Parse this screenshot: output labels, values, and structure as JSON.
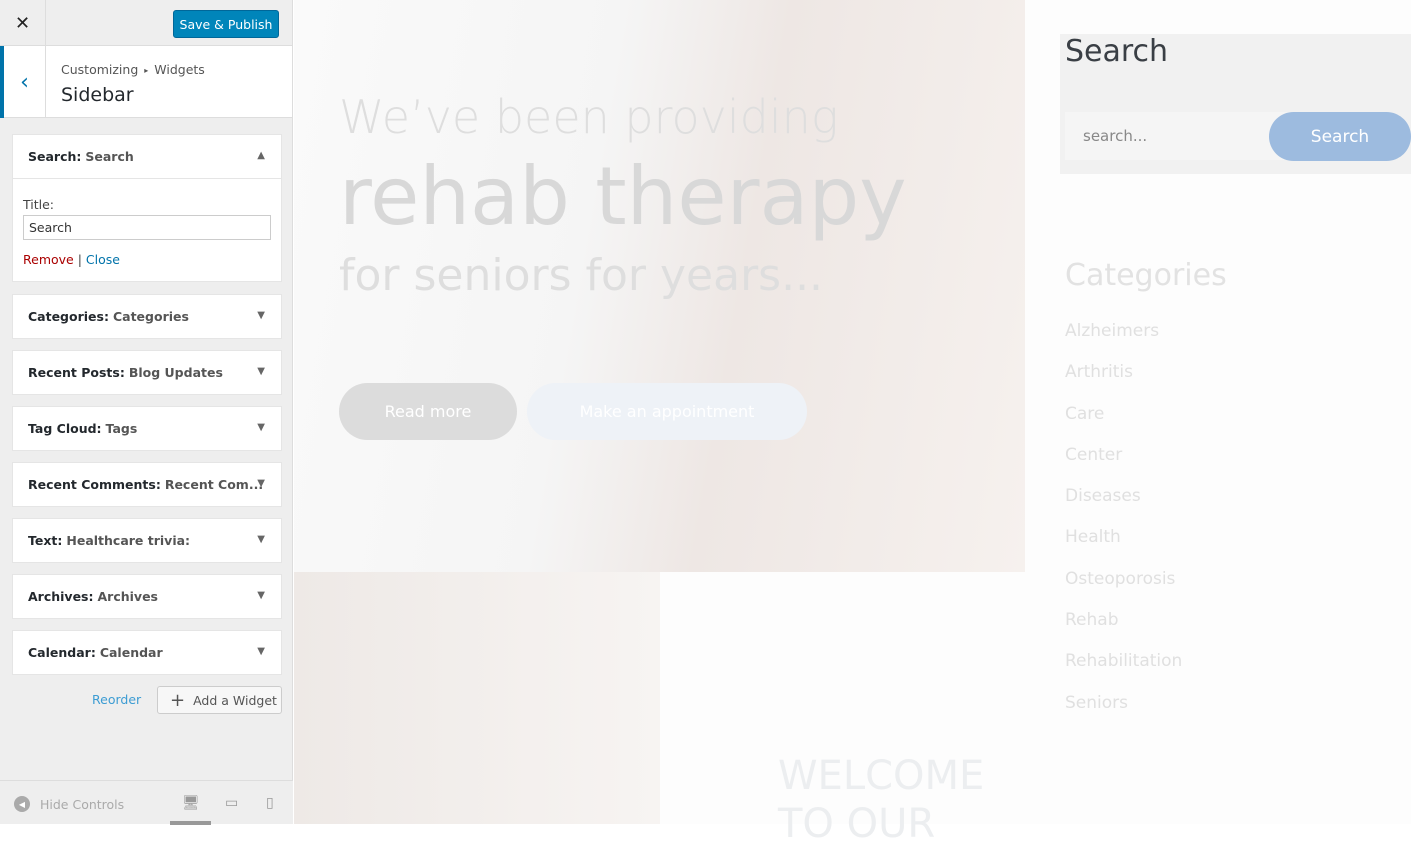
{
  "panel": {
    "close_icon": "close-icon",
    "publish": "Save & Publish",
    "breadcrumb": {
      "root": "Customizing",
      "separator": "▸",
      "section": "Widgets"
    },
    "title": "Sidebar",
    "expanded_widget": {
      "type": "Search:",
      "name": "Search",
      "title_label": "Title:",
      "title_value": "Search",
      "remove": "Remove",
      "sep": "|",
      "close": "Close"
    },
    "widgets": [
      {
        "type": "Categories:",
        "name": "Categories"
      },
      {
        "type": "Recent Posts:",
        "name": "Blog Updates"
      },
      {
        "type": "Tag Cloud:",
        "name": "Tags"
      },
      {
        "type": "Recent Comments:",
        "name": "Recent Com..."
      },
      {
        "type": "Text:",
        "name": "Healthcare trivia:"
      },
      {
        "type": "Archives:",
        "name": "Archives"
      },
      {
        "type": "Calendar:",
        "name": "Calendar"
      }
    ],
    "reorder": "Reorder",
    "add_widget": "Add a Widget",
    "hide_controls": "Hide Controls"
  },
  "preview": {
    "hero": {
      "line1": "We’ve been providing",
      "line2": "rehab therapy",
      "line3": "for seniors for years...",
      "read_more": "Read more",
      "appointment": "Make an appointment"
    },
    "welcome": [
      "WELCOME",
      "TO OUR"
    ],
    "search": {
      "title": "Search",
      "placeholder": "search...",
      "button": "Search"
    },
    "categories": {
      "title": "Categories",
      "items": [
        "Alzheimers",
        "Arthritis",
        "Care",
        "Center",
        "Diseases",
        "Health",
        "Osteoporosis",
        "Rehab",
        "Rehabilitation",
        "Seniors"
      ]
    }
  },
  "colors": {
    "accent": "#0085ba",
    "link": "#0073aa",
    "remove": "#aa0000",
    "search_button": "#9dbbdf"
  }
}
